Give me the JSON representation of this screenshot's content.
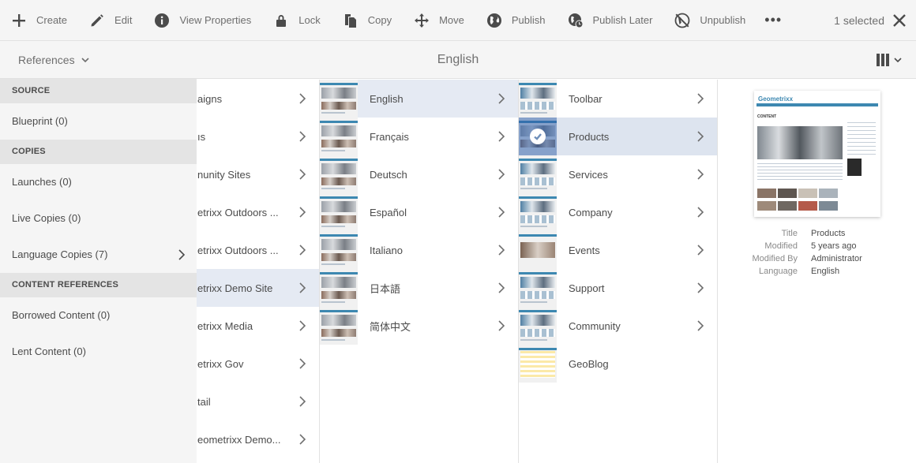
{
  "toolbar": {
    "items": [
      {
        "label": "Create",
        "icon": "plus-icon"
      },
      {
        "label": "Edit",
        "icon": "pencil-icon"
      },
      {
        "label": "View Properties",
        "icon": "info-icon"
      },
      {
        "label": "Lock",
        "icon": "lock-icon"
      },
      {
        "label": "Copy",
        "icon": "copy-icon"
      },
      {
        "label": "Move",
        "icon": "move-icon"
      },
      {
        "label": "Publish",
        "icon": "globe-icon"
      },
      {
        "label": "Publish Later",
        "icon": "globe-clock-icon"
      },
      {
        "label": "Unpublish",
        "icon": "globe-off-icon"
      }
    ],
    "more": "•••",
    "selection_text": "1 selected"
  },
  "subheader": {
    "references_label": "References",
    "title": "English"
  },
  "rail": {
    "source_heading": "SOURCE",
    "blueprint": "Blueprint (0)",
    "copies_heading": "COPIES",
    "launches": "Launches (0)",
    "live_copies": "Live Copies (0)",
    "language_copies": "Language Copies (7)",
    "content_refs_heading": "CONTENT REFERENCES",
    "borrowed": "Borrowed Content (0)",
    "lent": "Lent Content (0)"
  },
  "columns": {
    "sites": [
      "aigns",
      "ıs",
      "nunity Sites",
      "etrixx Outdoors ...",
      "etrixx Outdoors ...",
      "etrixx Demo Site",
      "etrixx Media",
      "etrixx Gov",
      "tail",
      "eometrixx Demo..."
    ],
    "languages": [
      "English",
      "Français",
      "Deutsch",
      "Español",
      "Italiano",
      "日本語",
      "简体中文"
    ],
    "pages": [
      "Toolbar",
      "Products",
      "Services",
      "Company",
      "Events",
      "Support",
      "Community",
      "GeoBlog"
    ]
  },
  "preview": {
    "logo_text": "Geometrixx",
    "content_heading": "CONTENT",
    "meta": [
      {
        "key": "Title",
        "value": "Products"
      },
      {
        "key": "Modified",
        "value": "5 years ago"
      },
      {
        "key": "Modified By",
        "value": "Administrator"
      },
      {
        "key": "Language",
        "value": "English"
      }
    ]
  },
  "colors": {
    "toolbar_bg": "#f5f5f5",
    "selected_row": "#dde4ef",
    "accent": "#3d88b1"
  }
}
